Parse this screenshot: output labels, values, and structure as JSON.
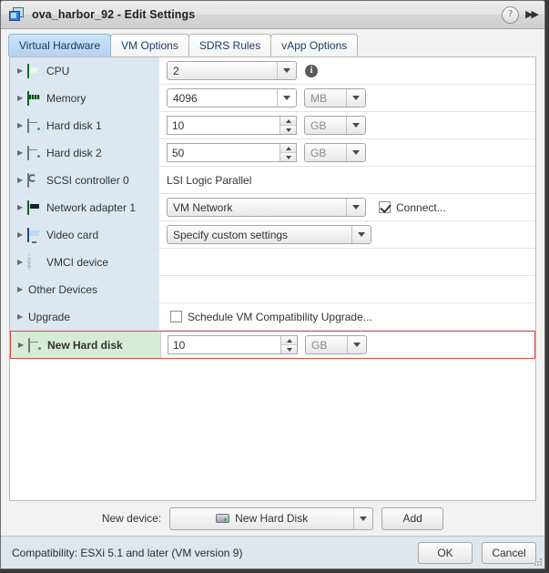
{
  "window": {
    "title": "ova_harbor_92 - Edit Settings",
    "app_icon": "virtual-machine-icon",
    "help_glyph": "?",
    "expand_glyph": "▶▶"
  },
  "tabs": [
    {
      "label": "Virtual Hardware",
      "active": true
    },
    {
      "label": "VM Options",
      "active": false
    },
    {
      "label": "SDRS Rules",
      "active": false
    },
    {
      "label": "vApp Options",
      "active": false
    }
  ],
  "hardware_rows": [
    {
      "label": "CPU",
      "icon": "cpu-icon",
      "value": "2",
      "unit": "",
      "control": "combo"
    },
    {
      "label": "Memory",
      "icon": "memory-icon",
      "value": "4096",
      "unit": "MB",
      "control": "combo-unit"
    },
    {
      "label": "Hard disk 1",
      "icon": "hard-disk-icon",
      "value": "10",
      "unit": "GB",
      "control": "spinner-unit"
    },
    {
      "label": "Hard disk 2",
      "icon": "hard-disk-icon",
      "value": "50",
      "unit": "GB",
      "control": "spinner-unit"
    },
    {
      "label": "SCSI controller 0",
      "icon": "scsi-controller-icon",
      "value": "LSI Logic Parallel",
      "unit": "",
      "control": "text"
    },
    {
      "label": "Network adapter 1",
      "icon": "network-adapter-icon",
      "value": "VM Network",
      "unit": "",
      "control": "combo-checkbox"
    },
    {
      "label": "Video card",
      "icon": "video-card-icon",
      "value": "Specify custom settings",
      "unit": "",
      "control": "combo-wide"
    },
    {
      "label": "VMCI device",
      "icon": "vmci-gear-icon",
      "value": "",
      "unit": "",
      "control": "none"
    },
    {
      "label": "Other Devices",
      "icon": "",
      "value": "",
      "unit": "",
      "control": "none"
    },
    {
      "label": "Upgrade",
      "icon": "",
      "value": "",
      "unit": "",
      "control": "checkbox"
    },
    {
      "label": "New Hard disk",
      "icon": "hard-disk-icon",
      "value": "10",
      "unit": "GB",
      "control": "spinner-unit"
    }
  ],
  "network": {
    "connect_label": "Connect...",
    "connect_checked": true
  },
  "upgrade": {
    "checkbox_label": "Schedule VM Compatibility Upgrade...",
    "checked": false
  },
  "new_device": {
    "label": "New device:",
    "selected": "New Hard Disk",
    "icon": "hard-disk-icon",
    "add_button": "Add"
  },
  "footer": {
    "compatibility": "Compatibility: ESXi 5.1 and later (VM version 9)",
    "ok_label": "OK",
    "cancel_label": "Cancel"
  },
  "colors": {
    "accent": "#b4d3ef",
    "label_column": "#dbe8f1",
    "new_device_row": "#d5ecd6",
    "new_device_border": "#e04a3f",
    "status_bar": "#dfe6ec"
  }
}
